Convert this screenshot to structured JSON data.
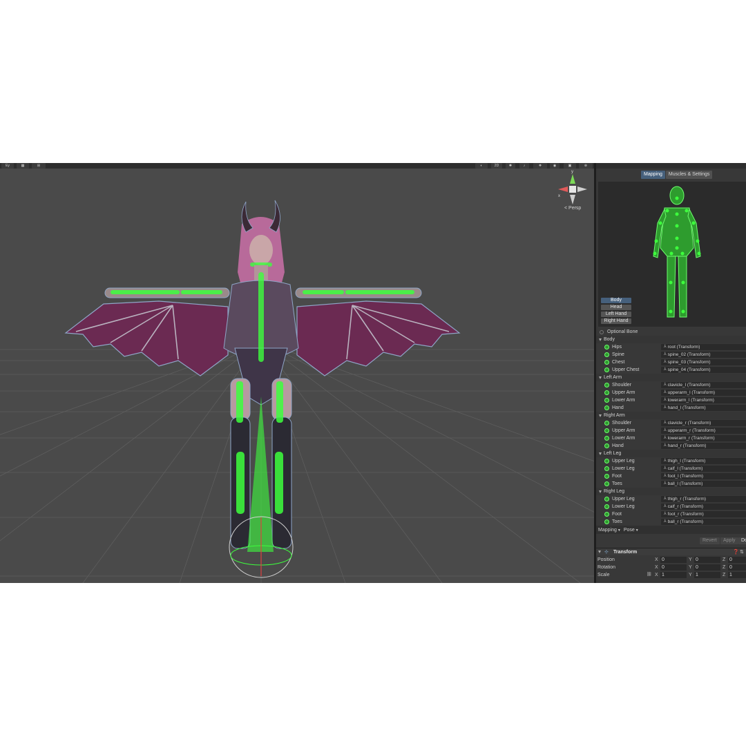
{
  "scene": {
    "toolbar_left": [
      "Ey",
      "▦",
      "⊞"
    ],
    "toolbar_right": [
      "2D",
      "💡",
      "🔊",
      "👁"
    ],
    "camera_mode": "< Persp",
    "gizmo_axes": {
      "y": "y",
      "x": "x"
    }
  },
  "inspector": {
    "tabs": [
      "Mapping",
      "Muscles & Settings"
    ],
    "active_tab": "Mapping",
    "body_parts": [
      "Body",
      "Head",
      "Left Hand",
      "Right Hand"
    ],
    "active_body_part": "Body",
    "optional_bone_label": "Optional Bone",
    "groups": [
      {
        "name": "Body",
        "bones": [
          {
            "label": "Hips",
            "transform": "root (Transform)"
          },
          {
            "label": "Spine",
            "transform": "spine_02 (Transform)"
          },
          {
            "label": "Chest",
            "transform": "spine_03 (Transform)"
          },
          {
            "label": "Upper Chest",
            "transform": "spine_04 (Transform)"
          }
        ]
      },
      {
        "name": "Left Arm",
        "bones": [
          {
            "label": "Shoulder",
            "transform": "clavicle_l (Transform)"
          },
          {
            "label": "Upper Arm",
            "transform": "upperarm_l (Transform)"
          },
          {
            "label": "Lower Arm",
            "transform": "lowerarm_l (Transform)"
          },
          {
            "label": "Hand",
            "transform": "hand_l (Transform)"
          }
        ]
      },
      {
        "name": "Right Arm",
        "bones": [
          {
            "label": "Shoulder",
            "transform": "clavicle_r (Transform)"
          },
          {
            "label": "Upper Arm",
            "transform": "upperarm_r (Transform)"
          },
          {
            "label": "Lower Arm",
            "transform": "lowerarm_r (Transform)"
          },
          {
            "label": "Hand",
            "transform": "hand_r (Transform)"
          }
        ]
      },
      {
        "name": "Left Leg",
        "bones": [
          {
            "label": "Upper Leg",
            "transform": "thigh_l (Transform)"
          },
          {
            "label": "Lower Leg",
            "transform": "calf_l (Transform)"
          },
          {
            "label": "Foot",
            "transform": "foot_l (Transform)"
          },
          {
            "label": "Toes",
            "transform": "ball_l (Transform)"
          }
        ]
      },
      {
        "name": "Right Leg",
        "bones": [
          {
            "label": "Upper Leg",
            "transform": "thigh_r (Transform)"
          },
          {
            "label": "Lower Leg",
            "transform": "calf_r (Transform)"
          },
          {
            "label": "Foot",
            "transform": "foot_r (Transform)"
          },
          {
            "label": "Toes",
            "transform": "ball_r (Transform)"
          }
        ]
      }
    ],
    "bottom_dropdowns": [
      "Mapping",
      "Pose"
    ],
    "actions": {
      "revert": "Revert",
      "apply": "Apply",
      "done": "Do"
    },
    "transform": {
      "title": "Transform",
      "rows": [
        {
          "label": "Position",
          "x": "0",
          "y": "0",
          "z": "0"
        },
        {
          "label": "Rotation",
          "x": "0",
          "y": "0",
          "z": "0"
        },
        {
          "label": "Scale",
          "x": "1",
          "y": "1",
          "z": "1"
        }
      ]
    }
  },
  "colors": {
    "bone_green": "#3dff3d",
    "selected_blue": "#46607c",
    "wing_purple": "#6b2a52",
    "viewport_bg": "#4a4a4a"
  }
}
